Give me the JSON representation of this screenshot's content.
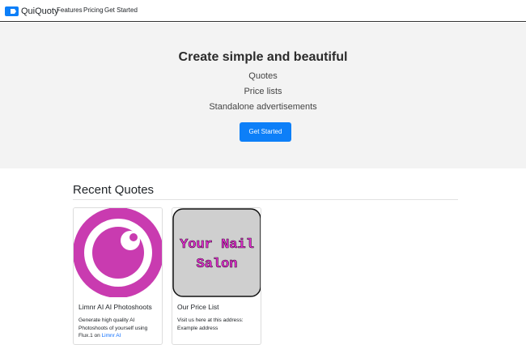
{
  "navbar": {
    "brand": "QuiQuoty",
    "links": [
      "Features",
      "Pricing",
      "Get Started"
    ]
  },
  "hero": {
    "title": "Create simple and beautiful",
    "items": [
      "Quotes",
      "Price lists",
      "Standalone advertisements"
    ],
    "cta_label": "Get Started"
  },
  "recent": {
    "heading": "Recent Quotes",
    "cards": [
      {
        "title": "Limnr AI AI Photoshoots",
        "text_lines": [
          "Generate high quality AI",
          "Photoshoots of yourself using"
        ],
        "text_partial": "Flux.1 on",
        "link_partial": "Limnr AI",
        "image_icon": "logo-circle-icon",
        "image_color": "#c93bb0"
      },
      {
        "title": "Our Price List",
        "text_lines": [
          "Visit us here at this address:",
          "Example address"
        ],
        "image_text_lines": [
          "Your Nail",
          "Salon"
        ],
        "image_bg": "#cfcfcf",
        "image_text_color": "#e82fd4"
      }
    ]
  },
  "colors": {
    "accent": "#0d7ff8",
    "hero_bg": "#f3f3f3",
    "magenta": "#c93bb0"
  }
}
